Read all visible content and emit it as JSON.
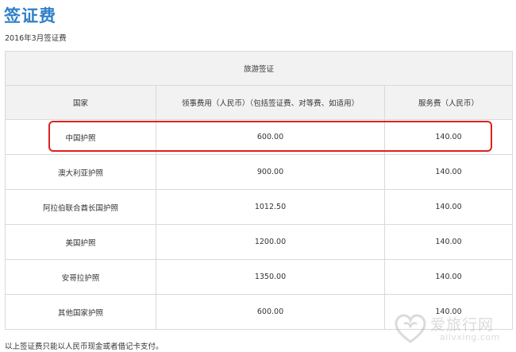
{
  "page": {
    "title": "签证费",
    "date": "2016年3月签证费",
    "footnote": "以上签证费只能以人民币现金或者借记卡支付。"
  },
  "table": {
    "group_header": "旅游签证",
    "columns": [
      "国家",
      "领事费用（人民币）（包括签证费、对等费、如适用）",
      "服务费（人民币）"
    ],
    "rows": [
      {
        "country": "中国护照",
        "consular_fee": "600.00",
        "service_fee": "140.00"
      },
      {
        "country": "澳大利亚护照",
        "consular_fee": "900.00",
        "service_fee": "140.00"
      },
      {
        "country": "阿拉伯联合酋长国护照",
        "consular_fee": "1012.50",
        "service_fee": "140.00"
      },
      {
        "country": "美国护照",
        "consular_fee": "1200.00",
        "service_fee": "140.00"
      },
      {
        "country": "安哥拉护照",
        "consular_fee": "1350.00",
        "service_fee": "140.00"
      },
      {
        "country": "其他国家护照",
        "consular_fee": "600.00",
        "service_fee": "140.00"
      }
    ]
  },
  "watermark": {
    "name": "爱旅行网",
    "domain": "ailvxing.com"
  },
  "colors": {
    "title": "#2f80c8",
    "highlight": "#e02020",
    "header_bg": "#f2f2f2",
    "border": "#d9d9d9"
  }
}
